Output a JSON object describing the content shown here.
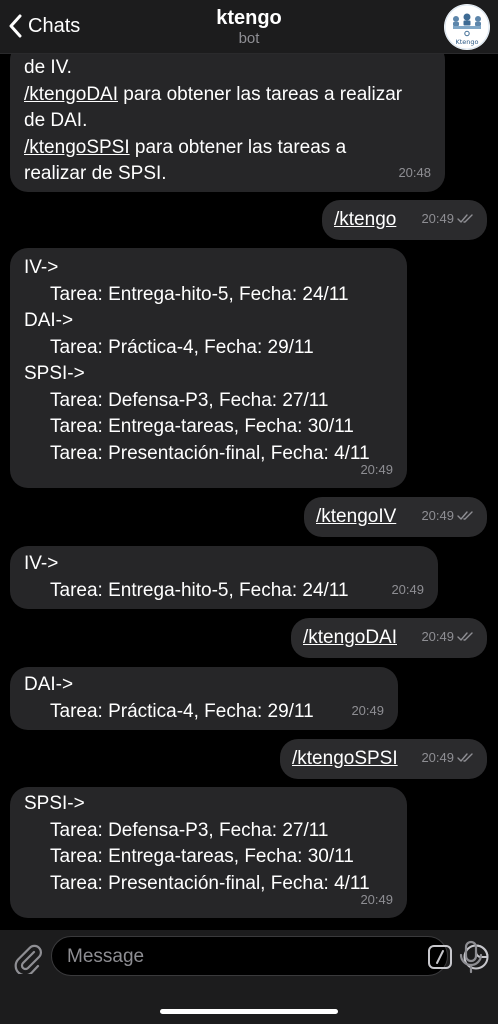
{
  "header": {
    "back_label": "Chats",
    "title": "ktengo",
    "subtitle": "bot",
    "avatar_text": "Ktengo"
  },
  "messages": [
    {
      "id": "m1",
      "dir": "in",
      "lines": [
        {
          "cmd": "",
          "text": "de IV."
        },
        {
          "cmd": "/ktengoDAI",
          "text": " para obtener las tareas a realizar"
        },
        {
          "cmd": "",
          "text": "de DAI."
        },
        {
          "cmd": "/ktengoSPSI",
          "text": " para obtener las tareas a"
        },
        {
          "cmd": "",
          "text": "realizar de SPSI."
        }
      ],
      "time": "20:48"
    },
    {
      "id": "m2",
      "dir": "out",
      "cmd": "/ktengo",
      "time": "20:49"
    },
    {
      "id": "m3",
      "dir": "in",
      "lines": [
        {
          "text": "IV->"
        },
        {
          "text": "Tarea: Entrega-hito-5, Fecha: 24/11"
        },
        {
          "text": "DAI->"
        },
        {
          "text": "Tarea: Práctica-4, Fecha: 29/11"
        },
        {
          "text": "SPSI->"
        },
        {
          "text": "Tarea: Defensa-P3, Fecha: 27/11"
        },
        {
          "text": "Tarea: Entrega-tareas, Fecha: 30/11"
        },
        {
          "text": "Tarea: Presentación-final, Fecha: 4/11"
        }
      ],
      "time": "20:49"
    },
    {
      "id": "m4",
      "dir": "out",
      "cmd": "/ktengoIV",
      "time": "20:49"
    },
    {
      "id": "m5",
      "dir": "in",
      "lines": [
        {
          "text": "IV->"
        },
        {
          "text": "Tarea: Entrega-hito-5, Fecha: 24/11"
        }
      ],
      "time": "20:49"
    },
    {
      "id": "m6",
      "dir": "out",
      "cmd": "/ktengoDAI",
      "time": "20:49"
    },
    {
      "id": "m7",
      "dir": "in",
      "lines": [
        {
          "text": "DAI->"
        },
        {
          "text": "Tarea: Práctica-4, Fecha: 29/11"
        }
      ],
      "time": "20:49"
    },
    {
      "id": "m8",
      "dir": "out",
      "cmd": "/ktengoSPSI",
      "time": "20:49"
    },
    {
      "id": "m9",
      "dir": "in",
      "lines": [
        {
          "text": "SPSI->"
        },
        {
          "text": "Tarea: Defensa-P3, Fecha: 27/11"
        },
        {
          "text": "Tarea: Entrega-tareas, Fecha: 30/11"
        },
        {
          "text": "Tarea: Presentación-final, Fecha: 4/11"
        }
      ],
      "time": "20:49"
    }
  ],
  "input": {
    "placeholder": "Message"
  },
  "colors": {
    "background": "#000000",
    "header": "#1c1c1d",
    "bubble_in": "#262628",
    "bubble_out": "#2b2b2d",
    "meta_text": "#8e8e93"
  },
  "icons": [
    "chevron-left-icon",
    "attach-icon",
    "bot-command-icon",
    "sticker-icon",
    "microphone-icon",
    "read-ticks-icon"
  ]
}
